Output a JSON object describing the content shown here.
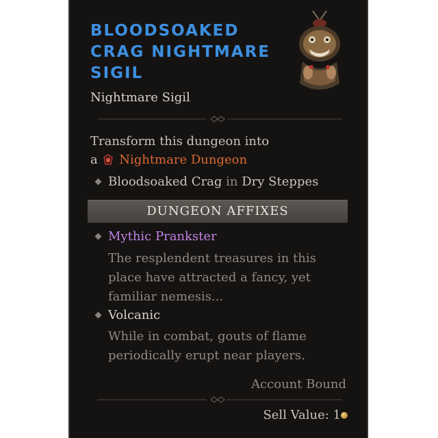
{
  "item": {
    "title_lines": [
      "Bloodsoaked",
      "Crag Nightmare",
      "Sigil"
    ],
    "subtitle": "Nightmare Sigil",
    "icon": "nightmare-sigil-icon"
  },
  "description": {
    "line1": "Transform this dungeon into",
    "line2_prefix": "a",
    "nightmare_icon": "nightmare-dungeon-icon",
    "line2_highlight": "Nightmare Dungeon",
    "location_dungeon": "Bloodsoaked Crag",
    "location_in": "in",
    "location_region": "Dry Steppes"
  },
  "affixes": {
    "header": "DUNGEON AFFIXES",
    "items": [
      {
        "name": "Mythic Prankster",
        "description_lines": [
          "The resplendent treasures in this",
          "place have attracted a fancy, yet",
          "familiar nemesis..."
        ]
      },
      {
        "name": "Volcanic",
        "description_lines": [
          "While in combat, gouts of flame",
          "periodically erupt near players."
        ]
      }
    ]
  },
  "footer": {
    "bound": "Account Bound",
    "sell_value": "Sell Value: 1",
    "currency_icon": "gold-coin-icon"
  },
  "colors": {
    "title": "#3d8fe0",
    "nightmare": "#d86a31",
    "mythic": "#c383e6",
    "background": "#151312"
  }
}
